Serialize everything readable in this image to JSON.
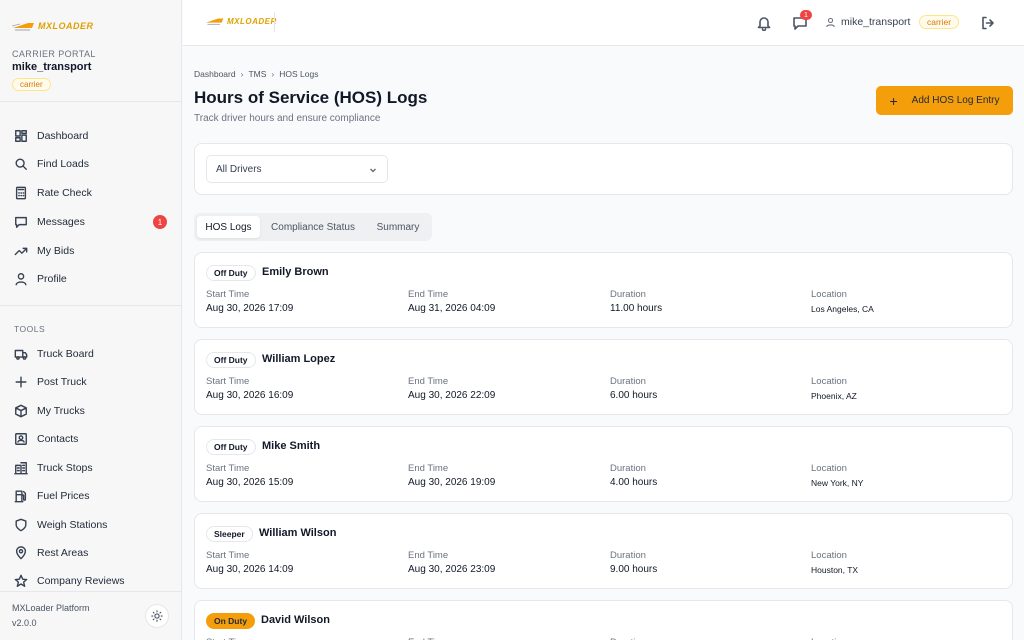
{
  "app": {
    "logo_text": "MXLOADER",
    "portal_label": "CARRIER PORTAL",
    "username": "mike_transport",
    "role": "carrier",
    "footer_name": "MXLoader Platform",
    "footer_version": "v2.0.0",
    "accent_color": "#f59e0b",
    "badge_color": "#ef4444"
  },
  "sidebar": {
    "main_items": [
      {
        "label": "Dashboard",
        "icon": "dashboard-icon"
      },
      {
        "label": "Find Loads",
        "icon": "search-icon"
      },
      {
        "label": "Rate Check",
        "icon": "calculator-icon"
      },
      {
        "label": "Messages",
        "icon": "message-icon",
        "badge": "1"
      },
      {
        "label": "My Bids",
        "icon": "trending-up-icon"
      },
      {
        "label": "Profile",
        "icon": "user-icon"
      }
    ],
    "tools_label": "TOOLS",
    "tool_items": [
      {
        "label": "Truck Board",
        "icon": "truck-icon"
      },
      {
        "label": "Post Truck",
        "icon": "plus-icon"
      },
      {
        "label": "My Trucks",
        "icon": "box-icon"
      },
      {
        "label": "Contacts",
        "icon": "contact-icon"
      },
      {
        "label": "Truck Stops",
        "icon": "building-icon"
      },
      {
        "label": "Fuel Prices",
        "icon": "fuel-icon"
      },
      {
        "label": "Weigh Stations",
        "icon": "shield-icon"
      },
      {
        "label": "Rest Areas",
        "icon": "map-pin-icon"
      },
      {
        "label": "Company Reviews",
        "icon": "star-icon"
      }
    ]
  },
  "header": {
    "message_badge": "1",
    "username": "mike_transport",
    "role": "carrier"
  },
  "page": {
    "breadcrumb": [
      "Dashboard",
      "TMS",
      "HOS Logs"
    ],
    "title": "Hours of Service (HOS) Logs",
    "subtitle": "Track driver hours and ensure compliance",
    "add_button": "Add HOS Log Entry",
    "driver_filter": "All Drivers",
    "tabs": [
      "HOS Logs",
      "Compliance Status",
      "Summary"
    ],
    "active_tab": "HOS Logs"
  },
  "columns": {
    "start": "Start Time",
    "end": "End Time",
    "duration": "Duration",
    "location": "Location"
  },
  "logs": [
    {
      "status": "Off Duty",
      "driver": "Emily Brown",
      "start": "Aug 30, 2026 17:09",
      "end": "Aug 31, 2026 04:09",
      "duration": "11.00 hours",
      "location": "Los Angeles, CA"
    },
    {
      "status": "Off Duty",
      "driver": "William Lopez",
      "start": "Aug 30, 2026 16:09",
      "end": "Aug 30, 2026 22:09",
      "duration": "6.00 hours",
      "location": "Phoenix, AZ"
    },
    {
      "status": "Off Duty",
      "driver": "Mike Smith",
      "start": "Aug 30, 2026 15:09",
      "end": "Aug 30, 2026 19:09",
      "duration": "4.00 hours",
      "location": "New York, NY"
    },
    {
      "status": "Sleeper",
      "driver": "William Wilson",
      "start": "Aug 30, 2026 14:09",
      "end": "Aug 30, 2026 23:09",
      "duration": "9.00 hours",
      "location": "Houston, TX"
    },
    {
      "status": "On Duty",
      "driver": "David Wilson"
    }
  ]
}
